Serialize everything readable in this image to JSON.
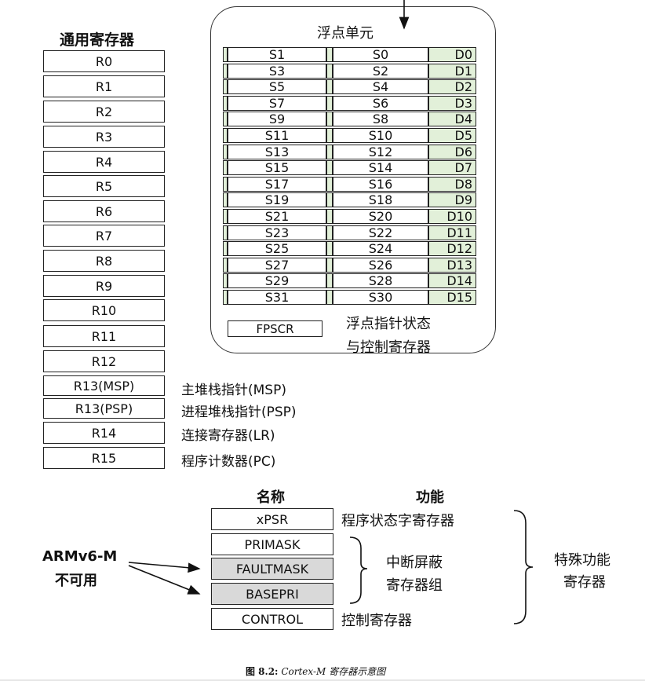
{
  "gpr": {
    "title": "通用寄存器",
    "registers": [
      "R0",
      "R1",
      "R2",
      "R3",
      "R4",
      "R5",
      "R6",
      "R7",
      "R8",
      "R9",
      "R10",
      "R11",
      "R12",
      "R13(MSP)",
      "R13(PSP)",
      "R14",
      "R15"
    ],
    "notes": {
      "msp": "主堆栈指针(MSP)",
      "psp": "进程堆栈指针(PSP)",
      "lr": "连接寄存器(LR)",
      "pc": "程序计数器(PC)"
    }
  },
  "fpu": {
    "title": "浮点单元",
    "rows": [
      {
        "odd": "S1",
        "even": "S0",
        "d": "D0"
      },
      {
        "odd": "S3",
        "even": "S2",
        "d": "D1"
      },
      {
        "odd": "S5",
        "even": "S4",
        "d": "D2"
      },
      {
        "odd": "S7",
        "even": "S6",
        "d": "D3"
      },
      {
        "odd": "S9",
        "even": "S8",
        "d": "D4"
      },
      {
        "odd": "S11",
        "even": "S10",
        "d": "D5"
      },
      {
        "odd": "S13",
        "even": "S12",
        "d": "D6"
      },
      {
        "odd": "S15",
        "even": "S14",
        "d": "D7"
      },
      {
        "odd": "S17",
        "even": "S16",
        "d": "D8"
      },
      {
        "odd": "S19",
        "even": "S18",
        "d": "D9"
      },
      {
        "odd": "S21",
        "even": "S20",
        "d": "D10"
      },
      {
        "odd": "S23",
        "even": "S22",
        "d": "D11"
      },
      {
        "odd": "S25",
        "even": "S24",
        "d": "D12"
      },
      {
        "odd": "S27",
        "even": "S26",
        "d": "D13"
      },
      {
        "odd": "S29",
        "even": "S28",
        "d": "D14"
      },
      {
        "odd": "S31",
        "even": "S30",
        "d": "D15"
      }
    ],
    "fpscr": "FPSCR",
    "fpscr_desc_1": "浮点指针状态",
    "fpscr_desc_2": "与控制寄存器"
  },
  "special": {
    "header_name": "名称",
    "header_function": "功能",
    "registers": [
      "xPSR",
      "PRIMASK",
      "FAULTMASK",
      "BASEPRI",
      "CONTROL"
    ],
    "xpsr_desc": "程序状态字寄存器",
    "control_desc": "控制寄存器",
    "interrupt_group_1": "中断屏蔽",
    "interrupt_group_2": "寄存器组",
    "special_1": "特殊功能",
    "special_2": "寄存器",
    "armv6_1": "ARMv6-M",
    "armv6_2": "不可用"
  },
  "caption": {
    "prefix": "图 8.2:",
    "text": "Cortex-M 寄存器示意图"
  },
  "colors": {
    "fpu_d_fill": "#e2f0d9",
    "armv6m_unavailable_fill": "#d9d9d9"
  }
}
